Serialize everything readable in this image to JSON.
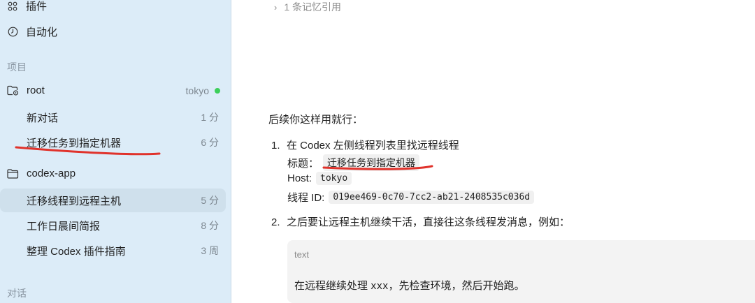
{
  "sidebar": {
    "nav": [
      {
        "label": "插件",
        "icon": "plugins-icon"
      },
      {
        "label": "自动化",
        "icon": "clock-icon"
      }
    ],
    "projects_label": "项目",
    "projects": [
      {
        "name": "root",
        "host": "tokyo",
        "status_color": "#3ccf5a",
        "threads": [
          {
            "title": "新对话",
            "time": "1 分"
          },
          {
            "title": "迁移任务到指定机器",
            "time": "6 分"
          }
        ]
      },
      {
        "name": "codex-app",
        "threads": [
          {
            "title": "迁移线程到远程主机",
            "time": "5 分",
            "active": true
          },
          {
            "title": "工作日晨间简报",
            "time": "8 分"
          },
          {
            "title": "整理 Codex 插件指南",
            "time": "3 周"
          }
        ]
      }
    ],
    "chats_label": "对话"
  },
  "main": {
    "memory_ref": "1 条记忆引用",
    "intro": "后续你这样用就行：",
    "step1": {
      "num": "1.",
      "text": "在 Codex 左侧线程列表里找远程线程",
      "title_label": "标题：",
      "title_value": "迁移任务到指定机器",
      "host_label": "Host:",
      "host_value": "tokyo",
      "thread_id_label": "线程 ID:",
      "thread_id_value": "019ee469-0c70-7cc2-ab21-2408535c036d"
    },
    "step2": {
      "num": "2.",
      "text": "之后要让远程主机继续干活，直接往这条线程发消息，例如："
    },
    "code_block": {
      "lang": "text",
      "pre": "在远程继续处理 ",
      "mono": "xxx",
      "post": "，先检查环境，然后开始跑。"
    }
  },
  "colors": {
    "sidebar_bg": "#dcecf8",
    "active_row": "#cfe0ec",
    "annotation_red": "#e0322b"
  }
}
